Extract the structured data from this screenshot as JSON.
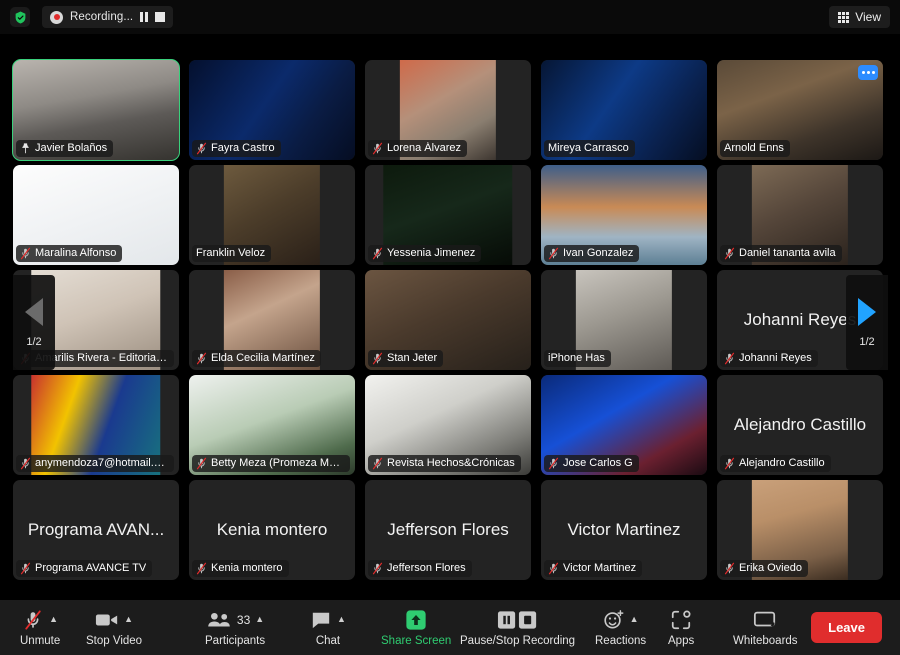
{
  "topbar": {
    "shield_icon": "encryption-shield-icon",
    "recording_label": "Recording...",
    "pause_icon": "pause-icon",
    "stop_icon": "stop-icon",
    "view_label": "View",
    "view_icon": "grid-view-icon"
  },
  "carousel": {
    "prev_icon": "chevron-left-icon",
    "next_icon": "chevron-right-icon",
    "page_indicator": "1/2"
  },
  "colors": {
    "active_speaker": "#3ad17c",
    "share_screen": "#2fcc71",
    "leave": "#e02d2d",
    "accent_blue": "#2d8cff",
    "next_arrow": "#21a3ff",
    "mute_red": "#e02b2b"
  },
  "participants": [
    {
      "name": "Javier Bolaños",
      "muted": false,
      "pinned": true,
      "active_speaker": true,
      "video": true,
      "more_menu": false
    },
    {
      "name": "Fayra Castro",
      "muted": true,
      "pinned": false,
      "active_speaker": false,
      "video": true,
      "more_menu": false
    },
    {
      "name": "Lorena Álvarez",
      "muted": true,
      "pinned": false,
      "active_speaker": false,
      "video": true,
      "more_menu": false
    },
    {
      "name": "Mireya Carrasco",
      "muted": false,
      "pinned": false,
      "active_speaker": false,
      "video": true,
      "more_menu": false
    },
    {
      "name": "Arnold Enns",
      "muted": false,
      "pinned": false,
      "active_speaker": false,
      "video": true,
      "more_menu": true
    },
    {
      "name": "Maralina Alfonso",
      "muted": true,
      "pinned": false,
      "active_speaker": false,
      "video": true,
      "more_menu": false
    },
    {
      "name": "Franklin Veloz",
      "muted": false,
      "pinned": false,
      "active_speaker": false,
      "video": true,
      "more_menu": false
    },
    {
      "name": "Yessenia Jimenez",
      "muted": true,
      "pinned": false,
      "active_speaker": false,
      "video": true,
      "more_menu": false
    },
    {
      "name": "Ivan Gonzalez",
      "muted": true,
      "pinned": false,
      "active_speaker": false,
      "video": true,
      "more_menu": false
    },
    {
      "name": "Daniel tananta avila",
      "muted": true,
      "pinned": false,
      "active_speaker": false,
      "video": true,
      "more_menu": false
    },
    {
      "name": "Amarilis Rivera - Editorial U...",
      "muted": true,
      "pinned": false,
      "active_speaker": false,
      "video": true,
      "more_menu": false
    },
    {
      "name": "Elda Cecilia Martínez",
      "muted": true,
      "pinned": false,
      "active_speaker": false,
      "video": true,
      "more_menu": false
    },
    {
      "name": "Stan Jeter",
      "muted": true,
      "pinned": false,
      "active_speaker": false,
      "video": true,
      "more_menu": false
    },
    {
      "name": "iPhone Has",
      "muted": false,
      "pinned": false,
      "active_speaker": false,
      "video": true,
      "more_menu": false
    },
    {
      "name": "Johanni Reyes",
      "muted": true,
      "pinned": false,
      "active_speaker": false,
      "video": false,
      "display_name": "Johanni Reyes",
      "more_menu": false
    },
    {
      "name": "anymendoza7@hotmail.com",
      "muted": true,
      "pinned": false,
      "active_speaker": false,
      "video": true,
      "more_menu": false
    },
    {
      "name": "Betty Meza (Promeza Mark...",
      "muted": true,
      "pinned": false,
      "active_speaker": false,
      "video": true,
      "more_menu": false
    },
    {
      "name": "Revista Hechos&Crónicas",
      "muted": true,
      "pinned": false,
      "active_speaker": false,
      "video": true,
      "more_menu": false
    },
    {
      "name": "Jose Carlos G",
      "muted": true,
      "pinned": false,
      "active_speaker": false,
      "video": true,
      "more_menu": false
    },
    {
      "name": "Alejandro Castillo",
      "muted": true,
      "pinned": false,
      "active_speaker": false,
      "video": false,
      "display_name": "Alejandro Castillo",
      "more_menu": false
    },
    {
      "name": "Programa AVANCE TV",
      "muted": true,
      "pinned": false,
      "active_speaker": false,
      "video": false,
      "display_name": "Programa AVAN...",
      "more_menu": false
    },
    {
      "name": "Kenia montero",
      "muted": true,
      "pinned": false,
      "active_speaker": false,
      "video": false,
      "display_name": "Kenia montero",
      "more_menu": false
    },
    {
      "name": "Jefferson Flores",
      "muted": true,
      "pinned": false,
      "active_speaker": false,
      "video": false,
      "display_name": "Jefferson Flores",
      "more_menu": false
    },
    {
      "name": "Victor Martinez",
      "muted": true,
      "pinned": false,
      "active_speaker": false,
      "video": false,
      "display_name": "Victor Martinez",
      "more_menu": false
    },
    {
      "name": "Erika Oviedo",
      "muted": true,
      "pinned": false,
      "active_speaker": false,
      "video": true,
      "more_menu": false
    }
  ],
  "toolbar": {
    "items": [
      {
        "id": "mute",
        "label": "Unmute",
        "icon": "mic-muted-icon",
        "caret": true,
        "count": null
      },
      {
        "id": "video",
        "label": "Stop Video",
        "icon": "video-camera-icon",
        "caret": true,
        "count": null
      },
      {
        "id": "participants",
        "label": "Participants",
        "icon": "participants-icon",
        "caret": true,
        "count": "33"
      },
      {
        "id": "chat",
        "label": "Chat",
        "icon": "chat-bubble-icon",
        "caret": true,
        "count": null
      },
      {
        "id": "share",
        "label": "Share Screen",
        "icon": "share-screen-icon",
        "caret": false,
        "count": null
      },
      {
        "id": "recording",
        "label": "Pause/Stop Recording",
        "icon": "pause-stop-icon",
        "caret": false,
        "count": null
      },
      {
        "id": "reactions",
        "label": "Reactions",
        "icon": "reactions-icon",
        "caret": true,
        "count": null
      },
      {
        "id": "apps",
        "label": "Apps",
        "icon": "apps-icon",
        "caret": false,
        "count": null
      },
      {
        "id": "whiteboards",
        "label": "Whiteboards",
        "icon": "whiteboard-icon",
        "caret": false,
        "count": null
      }
    ],
    "leave_label": "Leave"
  }
}
